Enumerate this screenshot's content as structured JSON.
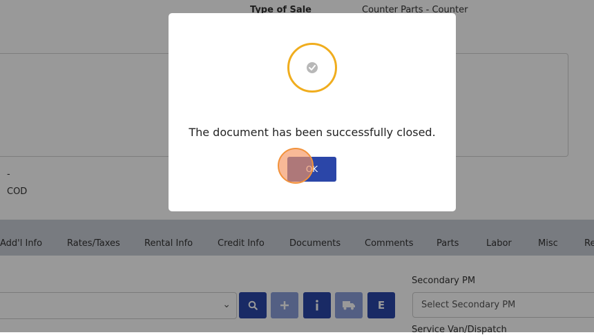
{
  "header": {
    "type_of_sale_label": "Type of Sale",
    "type_of_sale_value": "Counter Parts - Counter"
  },
  "info": {
    "dash": "-",
    "terms": "COD"
  },
  "tabs": [
    {
      "label": "Add'l Info"
    },
    {
      "label": "Rates/Taxes"
    },
    {
      "label": "Rental Info"
    },
    {
      "label": "Credit Info"
    },
    {
      "label": "Documents"
    },
    {
      "label": "Comments"
    },
    {
      "label": "Parts"
    },
    {
      "label": "Labor"
    },
    {
      "label": "Misc"
    },
    {
      "label": "Re"
    }
  ],
  "toolbar": {
    "buttons": [
      {
        "name": "search-icon",
        "label": ""
      },
      {
        "name": "plus-icon",
        "label": ""
      },
      {
        "name": "info-icon",
        "label": ""
      },
      {
        "name": "truck-icon",
        "label": ""
      },
      {
        "name": "e-button",
        "label": "E"
      }
    ]
  },
  "secondary_pm": {
    "label": "Secondary PM",
    "placeholder": "Select Secondary PM"
  },
  "service_van": {
    "label": "Service Van/Dispatch"
  },
  "modal": {
    "message": "The document has been successfully closed.",
    "ok_label": "OK",
    "ring_color": "#f0ad1e",
    "button_color": "#2b46a8"
  }
}
